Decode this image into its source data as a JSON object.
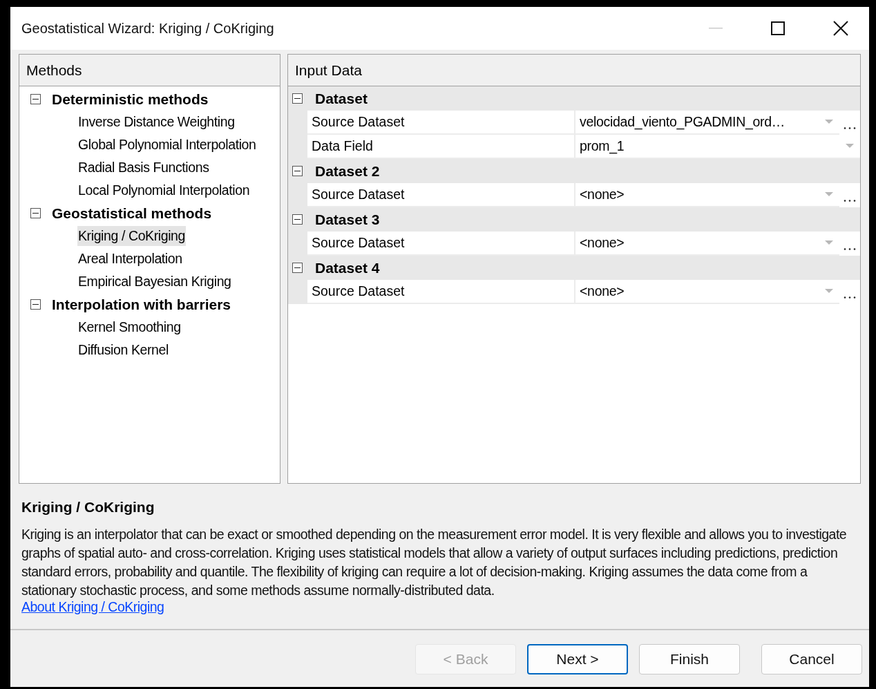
{
  "window": {
    "title": "Geostatistical Wizard: Kriging / CoKriging"
  },
  "methods": {
    "header": "Methods",
    "groups": [
      {
        "label": "Deterministic methods",
        "expanded": true,
        "children": [
          {
            "label": "Inverse Distance Weighting",
            "selected": false
          },
          {
            "label": "Global Polynomial Interpolation",
            "selected": false
          },
          {
            "label": "Radial Basis Functions",
            "selected": false
          },
          {
            "label": "Local Polynomial Interpolation",
            "selected": false
          }
        ]
      },
      {
        "label": "Geostatistical methods",
        "expanded": true,
        "children": [
          {
            "label": "Kriging / CoKriging",
            "selected": true
          },
          {
            "label": "Areal Interpolation",
            "selected": false
          },
          {
            "label": "Empirical Bayesian Kriging",
            "selected": false
          }
        ]
      },
      {
        "label": "Interpolation with barriers",
        "expanded": true,
        "children": [
          {
            "label": "Kernel Smoothing",
            "selected": false
          },
          {
            "label": "Diffusion Kernel",
            "selected": false
          }
        ]
      }
    ]
  },
  "input_data": {
    "header": "Input Data",
    "categories": [
      {
        "label": "Dataset",
        "expanded": true,
        "properties": [
          {
            "name": "Source Dataset",
            "value": "velocidad_viento_PGADMIN_ord…",
            "ellipsis": true
          },
          {
            "name": "Data Field",
            "value": "prom_1",
            "ellipsis": false
          }
        ]
      },
      {
        "label": "Dataset 2",
        "expanded": true,
        "properties": [
          {
            "name": "Source Dataset",
            "value": "<none>",
            "ellipsis": true
          }
        ]
      },
      {
        "label": "Dataset 3",
        "expanded": true,
        "properties": [
          {
            "name": "Source Dataset",
            "value": "<none>",
            "ellipsis": true
          }
        ]
      },
      {
        "label": "Dataset 4",
        "expanded": true,
        "properties": [
          {
            "name": "Source Dataset",
            "value": "<none>",
            "ellipsis": true
          }
        ]
      }
    ]
  },
  "description": {
    "title": "Kriging / CoKriging",
    "text": "Kriging is an interpolator that can be exact or smoothed depending on the measurement error model. It is very flexible and allows you to investigate graphs of spatial auto- and cross-correlation. Kriging uses statistical models that allow a variety of output surfaces including predictions, prediction standard errors, probability and quantile. The flexibility of kriging can require a lot of decision-making. Kriging assumes the data come from a stationary stochastic process, and some methods assume normally-distributed data.",
    "link": "About Kriging / CoKriging"
  },
  "buttons": [
    {
      "label": "< Back",
      "disabled": true,
      "default": false
    },
    {
      "label": "Next >",
      "disabled": false,
      "default": true
    },
    {
      "label": "Finish",
      "disabled": false,
      "default": false
    },
    {
      "label": "Cancel",
      "disabled": false,
      "default": false
    }
  ]
}
